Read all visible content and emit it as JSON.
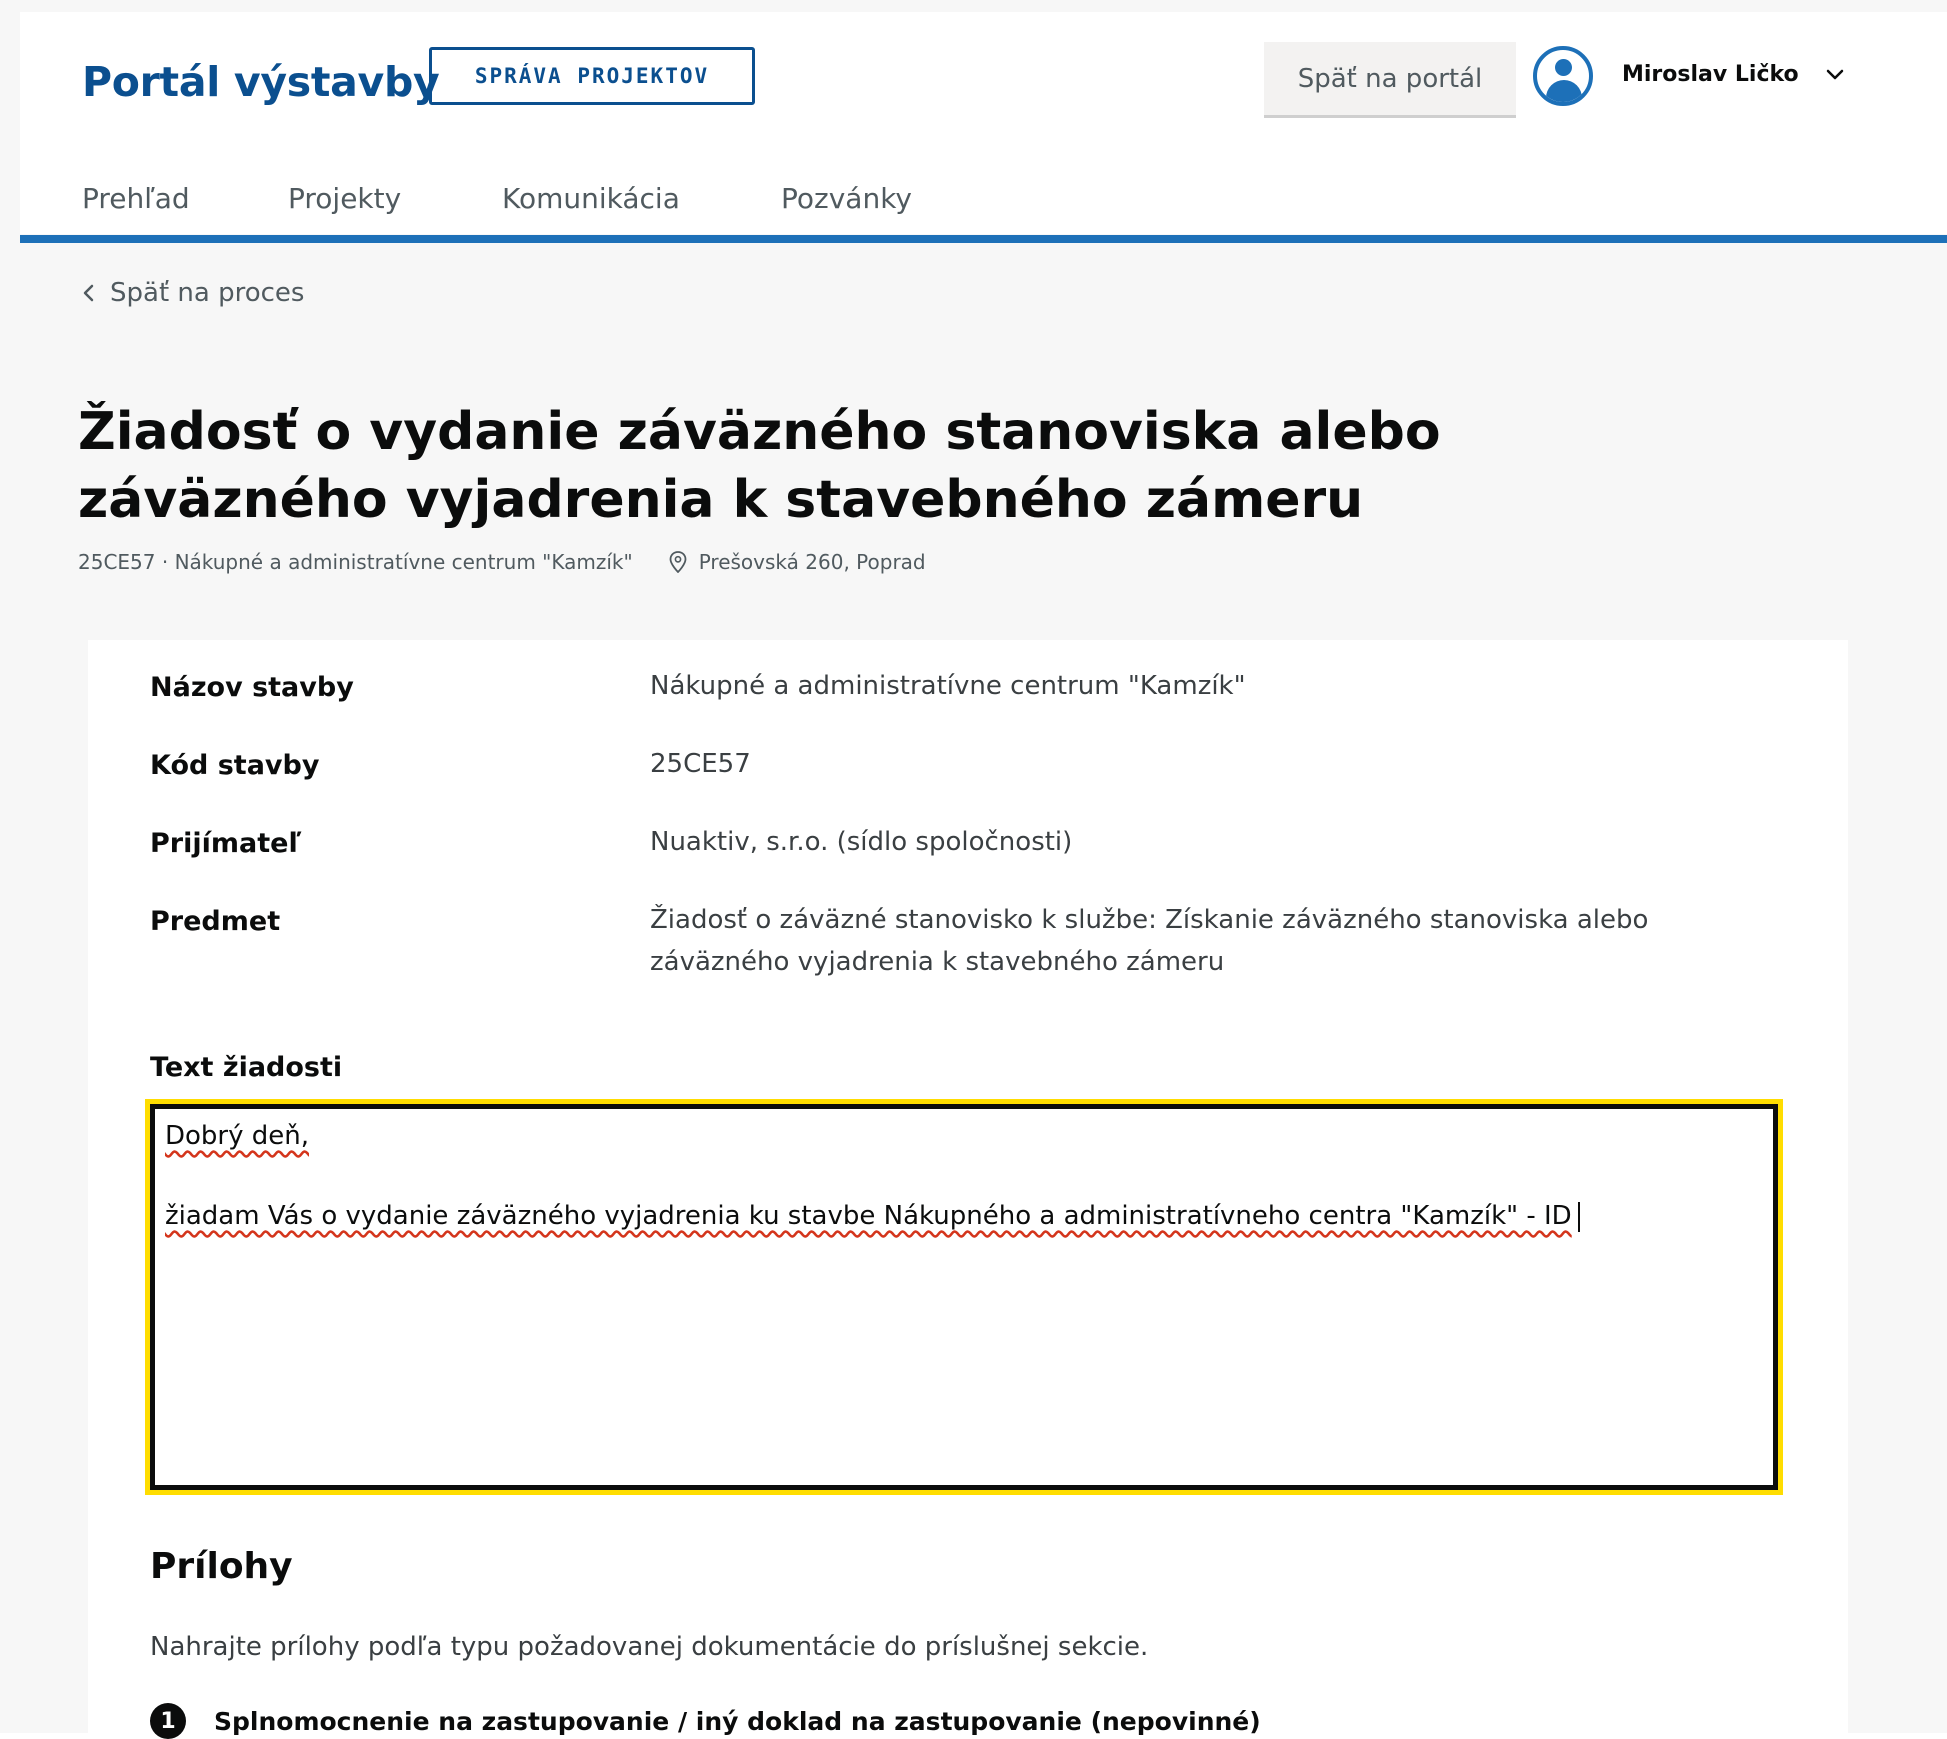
{
  "header": {
    "brand": "Portál výstavby",
    "badge": "SPRÁVA PROJEKTOV",
    "back_to_portal": "Späť na portál",
    "user_name": "Miroslav Ličko",
    "avatar_icon": "user-icon",
    "user_menu_icon": "chevron-down-icon"
  },
  "nav": {
    "items": [
      "Prehľad",
      "Projekty",
      "Komunikácia",
      "Pozvánky"
    ]
  },
  "breadcrumb": {
    "back_label": "Späť na proces"
  },
  "page": {
    "title": "Žiadosť o vydanie záväzného stanoviska alebo záväzného vyjadrenia k stavebného zámeru",
    "project_ref": "25CE57 · Nákupné a administratívne centrum \"Kamzík\"",
    "address": "Prešovská 260, Poprad"
  },
  "details": [
    {
      "label": "Názov stavby",
      "value": "Nákupné a administratívne centrum \"Kamzík\""
    },
    {
      "label": "Kód stavby",
      "value": "25CE57"
    },
    {
      "label": "Prijímateľ",
      "value": "Nuaktiv, s.r.o. (sídlo spoločnosti)"
    },
    {
      "label": "Predmet",
      "value": "Žiadosť o záväzné stanovisko k službe: Získanie záväzného stanoviska alebo záväzného vyjadrenia k stavebného zámeru"
    }
  ],
  "request": {
    "label": "Text žiadosti",
    "line1": "Dobrý deň,",
    "line2": "žiadam Vás o vydanie záväzného vyjadrenia ku stavbe Nákupného a administratívneho centra \"Kamzík\" - ID"
  },
  "attachments": {
    "title": "Prílohy",
    "description": "Nahrajte prílohy podľa typu požadovanej dokumentácie do príslušnej sekcie.",
    "items": [
      {
        "number": "1",
        "label": "Splnomocnenie na zastupovanie / iný doklad na zastupovanie (nepovinné)"
      }
    ]
  },
  "colors": {
    "brand": "#0b4f8f",
    "accent": "#1d70b8",
    "focus": "#ffdd00",
    "spellcheck": "#d4351c"
  }
}
